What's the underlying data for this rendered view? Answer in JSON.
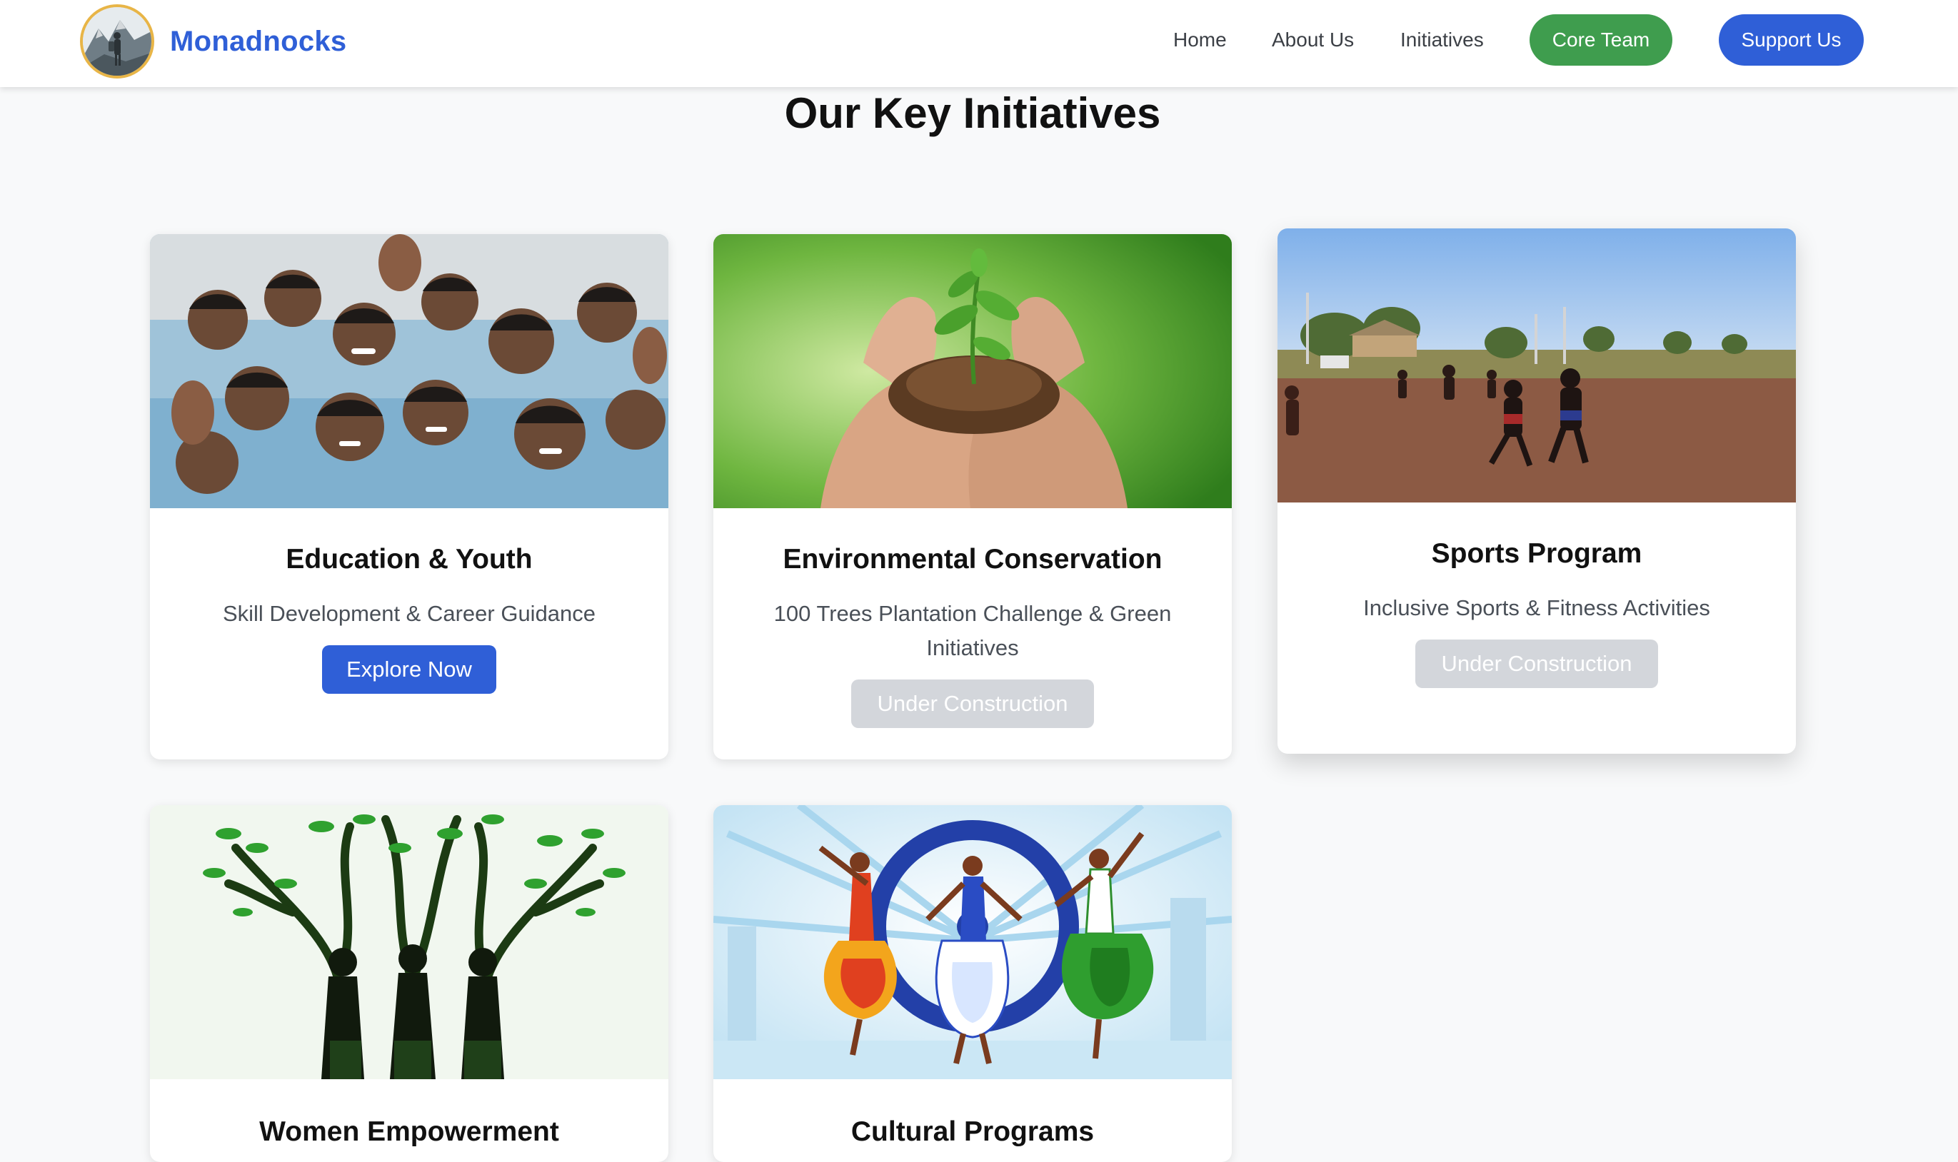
{
  "brand": {
    "name": "Monadnocks",
    "logo_icon": "mountain-hiker-logo"
  },
  "nav": {
    "links": [
      "Home",
      "About Us",
      "Initiatives"
    ],
    "core_team": "Core Team",
    "support_us": "Support Us"
  },
  "page": {
    "title": "Our Key Initiatives"
  },
  "cards": [
    {
      "title": "Education & Youth",
      "description": "Skill Development & Career Guidance",
      "button": "Explore Now",
      "image": "students-group-photo"
    },
    {
      "title": "Environmental Conservation",
      "description": "100 Trees Plantation Challenge & Green Initiatives",
      "button": "Under Construction",
      "image": "hands-holding-seedling-photo"
    },
    {
      "title": "Sports Program",
      "description": "Inclusive Sports & Fitness Activities",
      "button": "Under Construction",
      "image": "children-running-field-photo"
    },
    {
      "title": "Women Empowerment",
      "image": "women-tree-silhouette-illustration"
    },
    {
      "title": "Cultural Programs",
      "image": "indian-classical-dancers-illustration"
    }
  ],
  "colors": {
    "primary": "#2f5fd7",
    "success": "#3f9d4e",
    "disabled": "#d3d6db",
    "background": "#f8f9fa"
  }
}
